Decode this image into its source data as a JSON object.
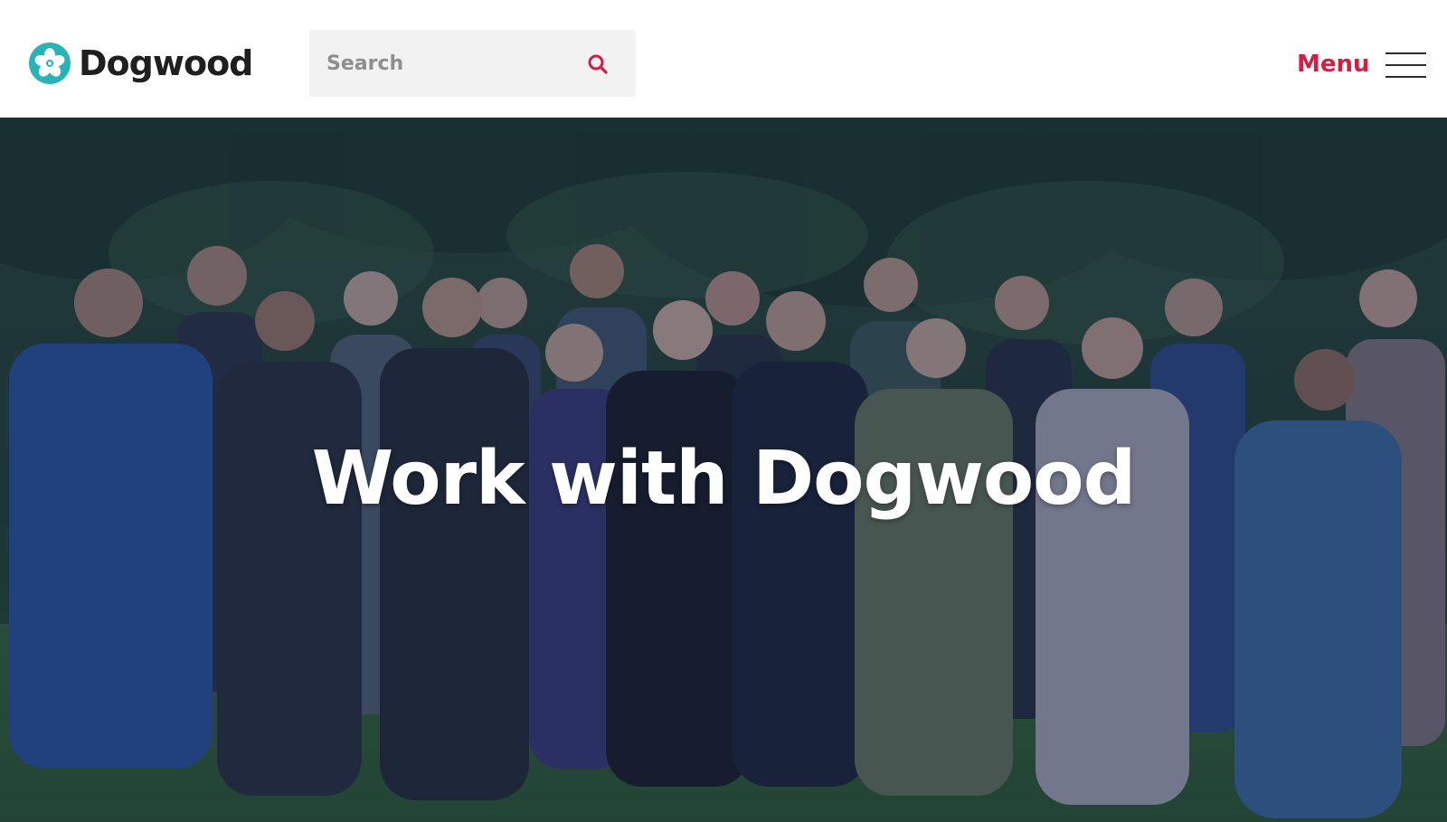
{
  "header": {
    "logo": {
      "text": "Dogwood",
      "icon": "dogwood-flower-icon",
      "color": "#2ab3b6"
    },
    "search": {
      "placeholder": "Search",
      "icon": "search-icon",
      "icon_color": "#d31e44"
    },
    "menu": {
      "label": "Menu",
      "icon": "hamburger-menu-icon",
      "color": "#d31e44"
    }
  },
  "hero": {
    "title": "Work with Dogwood",
    "image": "group-photo-in-forest"
  }
}
